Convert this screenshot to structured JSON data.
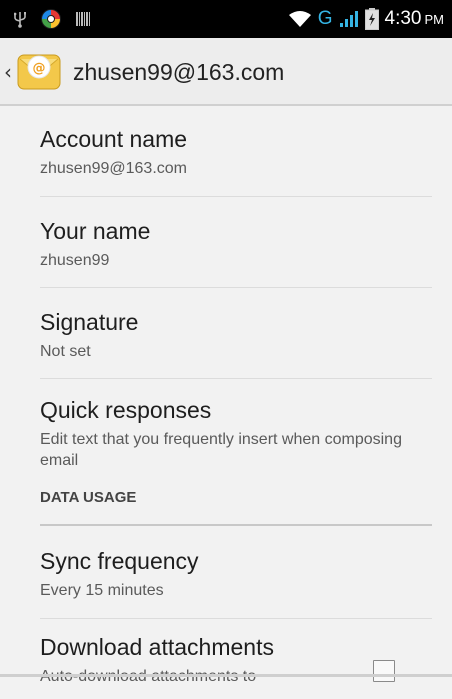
{
  "status_bar": {
    "network_type": "G",
    "time": "4:30",
    "ampm": "PM",
    "icons": [
      "usb-icon",
      "app-notification-icon",
      "barcode-icon",
      "wifi-icon",
      "signal-icon",
      "battery-icon"
    ],
    "accent_color": "#35b5e5"
  },
  "action_bar": {
    "title": "zhusen99@163.com",
    "up_glyph": "‹"
  },
  "settings": {
    "account_name": {
      "title": "Account name",
      "summary": "zhusen99@163.com"
    },
    "your_name": {
      "title": "Your name",
      "summary": "zhusen99"
    },
    "signature": {
      "title": "Signature",
      "summary": "Not set"
    },
    "quick_responses": {
      "title": "Quick responses",
      "summary": "Edit text that you frequently insert when composing email"
    },
    "data_usage_header": "DATA USAGE",
    "sync_frequency": {
      "title": "Sync frequency",
      "summary": "Every 15 minutes"
    },
    "download_attachments": {
      "title": "Download attachments",
      "summary": "Auto-download attachments to",
      "checked": false
    }
  }
}
